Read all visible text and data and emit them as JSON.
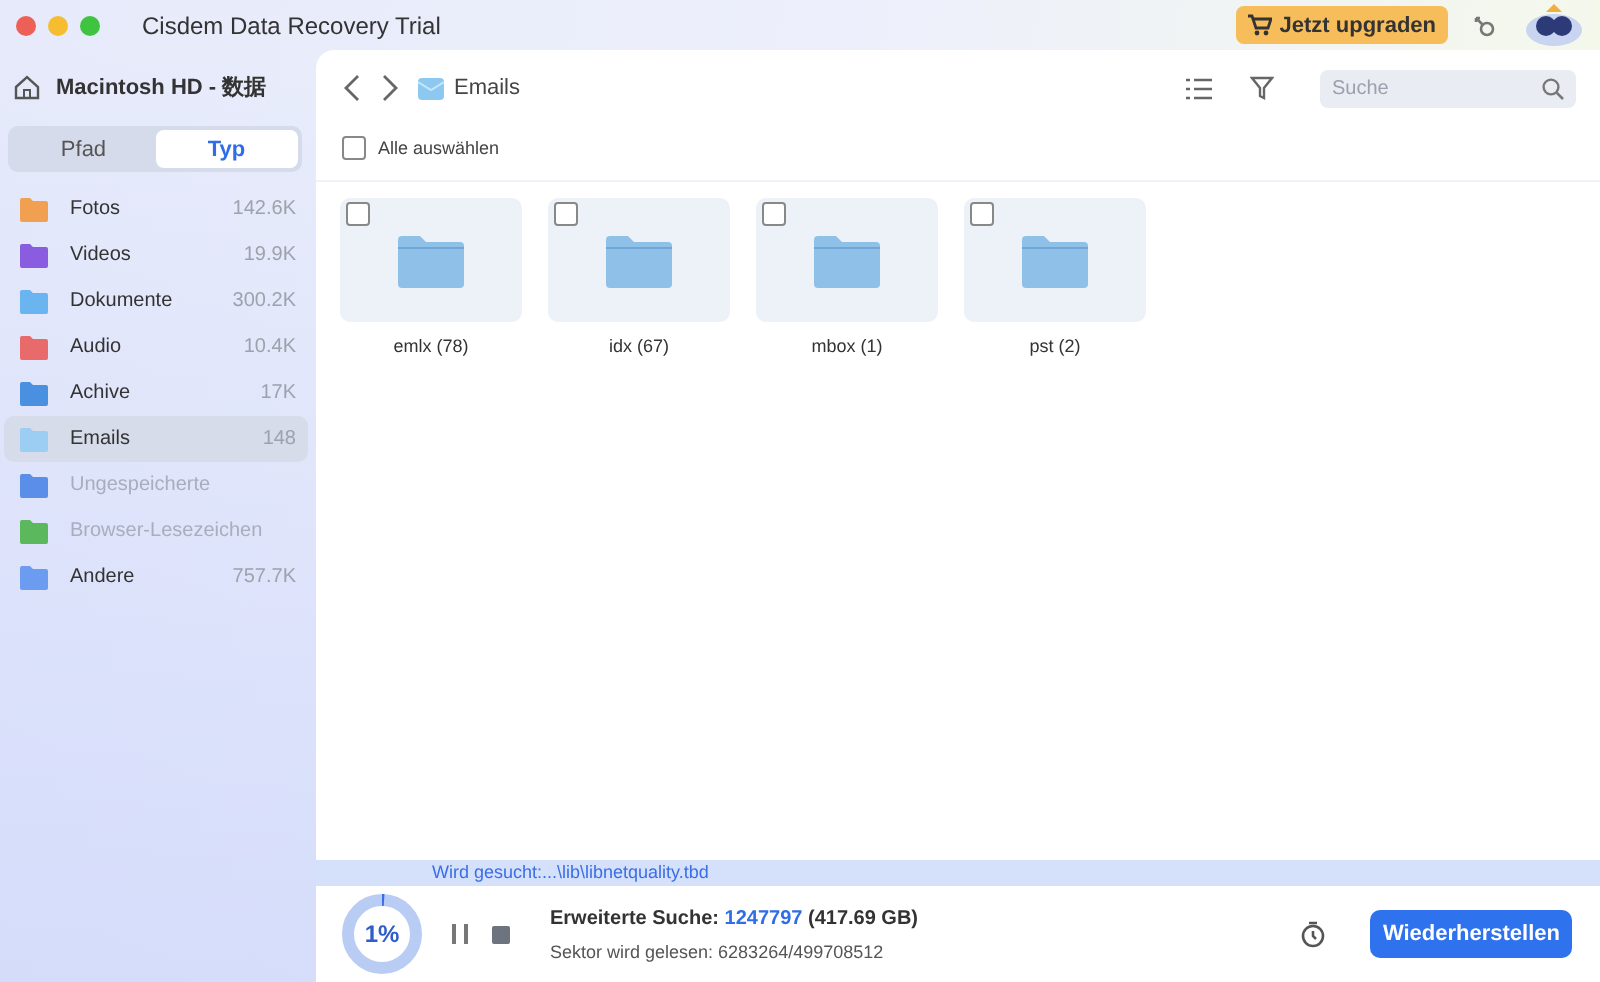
{
  "window": {
    "title": "Cisdem Data Recovery  Trial"
  },
  "upgrade_button": "Jetzt upgraden",
  "sidebar": {
    "drive": "Macintosh  HD - 数据",
    "tabs": [
      {
        "label": "Pfad",
        "selected": false
      },
      {
        "label": "Typ",
        "selected": true
      }
    ],
    "items": [
      {
        "label": "Fotos",
        "count": "142.6K",
        "color": "#f0a050",
        "selected": false,
        "disabled": false
      },
      {
        "label": "Videos",
        "count": "19.9K",
        "color": "#8a5ce0",
        "selected": false,
        "disabled": false
      },
      {
        "label": "Dokumente",
        "count": "300.2K",
        "color": "#6ab4f0",
        "selected": false,
        "disabled": false
      },
      {
        "label": "Audio",
        "count": "10.4K",
        "color": "#e86a6a",
        "selected": false,
        "disabled": false
      },
      {
        "label": "Achive",
        "count": "17K",
        "color": "#4a90e0",
        "selected": false,
        "disabled": false
      },
      {
        "label": "Emails",
        "count": "148",
        "color": "#9ccdf2",
        "selected": true,
        "disabled": false
      },
      {
        "label": "Ungespeicherte",
        "color": "#5a8ee8",
        "selected": false,
        "disabled": true
      },
      {
        "label": "Browser-Lesezeichen",
        "color": "#5cb85c",
        "selected": false,
        "disabled": true
      },
      {
        "label": "Andere",
        "count": "757.7K",
        "color": "#6c9cf0",
        "selected": false,
        "disabled": false
      }
    ]
  },
  "breadcrumb": "Emails",
  "search": {
    "placeholder": "Suche"
  },
  "select_all": {
    "label": "Alle auswählen",
    "checked": false
  },
  "folders": [
    {
      "label": "emlx (78)",
      "checked": false
    },
    {
      "label": "idx (67)",
      "checked": false
    },
    {
      "label": "mbox (1)",
      "checked": false
    },
    {
      "label": "pst (2)",
      "checked": false
    }
  ],
  "scan": {
    "current_path": "Wird gesucht:...\\lib\\libnetquality.tbd",
    "level": 0.01,
    "percent": "1%",
    "label": "Erweiterte Suche:",
    "found": "1247797",
    "size": "(417.69 GB)",
    "sector": "Sektor wird gelesen: 6283264/499708512"
  },
  "recover_button": "Wiederherstellen"
}
